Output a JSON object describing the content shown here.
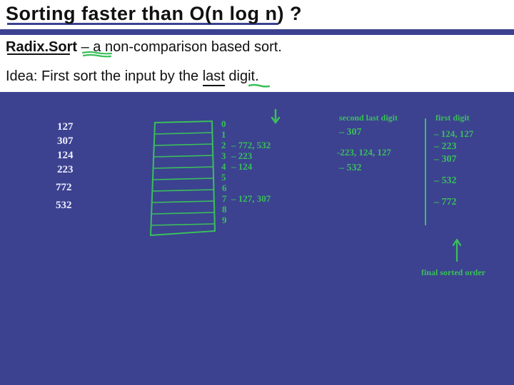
{
  "title": "Sorting faster than O(n log n) ?",
  "sub1_bold": "Radix.Sort",
  "sub1_rest": " – a non-comparison based sort.",
  "sub2_pre": "Idea: First sort the input by the ",
  "sub2_last": "last",
  "sub2_post": " digit.",
  "input_numbers": [
    "127",
    "307",
    "124",
    "223",
    "772",
    "532"
  ],
  "bucket_labels": [
    "0",
    "1",
    "2",
    "3",
    "4",
    "5",
    "6",
    "7",
    "8",
    "9"
  ],
  "bucket_fill": {
    "2": "– 772, 532",
    "3": "– 223",
    "4": "– 124",
    "7": "– 127, 307"
  },
  "col2_header": "second last digit",
  "col2_items": [
    "– 307",
    "-223, 124, 127",
    "– 532"
  ],
  "col3_header": "first digit",
  "col3_items": [
    "– 124, 127",
    "– 223",
    "– 307",
    "– 532",
    "– 772"
  ],
  "final_label": "final sorted order"
}
